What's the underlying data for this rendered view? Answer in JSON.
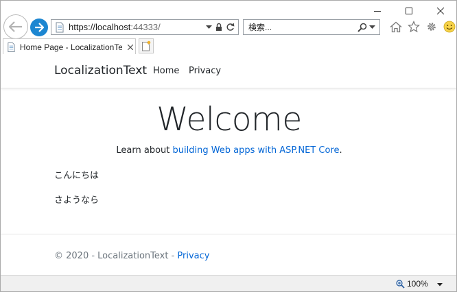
{
  "browser": {
    "url_host": "https://localhost",
    "url_port": ":44333/",
    "search_placeholder": "検索...",
    "tab_title": "Home Page - LocalizationTe...",
    "zoom_level": "100%",
    "icons": [
      "back-arrow-icon",
      "forward-arrow-icon",
      "page-icon",
      "dropdown-icon",
      "lock-icon",
      "refresh-icon",
      "search-icon",
      "home-icon",
      "favorites-star-icon",
      "settings-gear-icon",
      "smiley-feedback-icon",
      "new-tab-icon",
      "zoom-icon"
    ],
    "accent": "#1c86d1"
  },
  "navbar": {
    "brand": "LocalizationText",
    "links": [
      "Home",
      "Privacy"
    ]
  },
  "main": {
    "heading": "Welcome",
    "learn_prefix": "Learn about ",
    "learn_link": "building Web apps with ASP.NET Core",
    "learn_suffix": ".",
    "greeting": "こんにちは",
    "farewell": "さようなら"
  },
  "footer": {
    "text": "© 2020 - LocalizationText - ",
    "link": "Privacy"
  },
  "colors": {
    "link": "#0366d6",
    "text": "#212529",
    "muted": "#6c757d"
  }
}
